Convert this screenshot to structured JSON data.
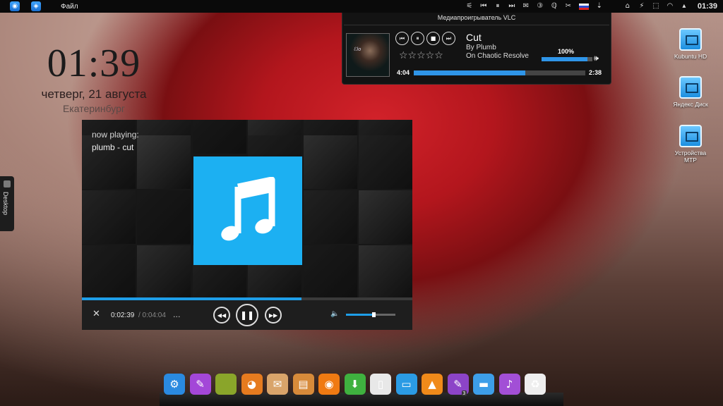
{
  "top_panel": {
    "menu_label": "Файл",
    "tray_items": [
      "⚟",
      "⏮",
      "⏸",
      "⏭",
      "✉",
      "③",
      "ℚ",
      "✂",
      "⇣",
      "",
      "⌂",
      "⚡",
      "⬚",
      "◠",
      "▴"
    ],
    "clock": "01:39"
  },
  "clock_widget": {
    "time": "01:39",
    "date": "четверг, 21 августа",
    "city": "Екатеринбург"
  },
  "desktop_tab": {
    "label": "Desktop"
  },
  "vlc": {
    "title": "Медиапроигрыватель VLC",
    "cover_text": "ℰlo",
    "buttons": [
      "⏮",
      "⏸",
      "■",
      "⏭"
    ],
    "rating": "☆☆☆☆☆",
    "track": {
      "title": "Cut",
      "artist": "By Plumb",
      "album": "On Chaotic Resolve"
    },
    "volume": {
      "label": "100%",
      "fraction": 0.9
    },
    "time": {
      "elapsed": "4:04",
      "remaining": "2:38",
      "fraction": 0.65
    }
  },
  "desktop_icons": [
    {
      "label": "Kubuntu HD"
    },
    {
      "label": "Яндекс Диск"
    },
    {
      "label": "Устройства MTP"
    }
  ],
  "music_player": {
    "now_playing_label": "now playing:",
    "now_playing_track": "plumb - cut",
    "art_icon": "music-note-icon",
    "progress_fraction": 0.664,
    "elapsed": "0:02:39",
    "total": "/ 0:04:04",
    "more": "...",
    "volume_fraction": 0.55,
    "tile_colors": [
      "#2a2a2a",
      "#353535",
      "#1f1f1f",
      "#3a3a3a",
      "#262626",
      "#2e2e2e",
      "#303030",
      "#444444",
      "#242424",
      "#3b3b3b",
      "#282828",
      "#2c2c2c",
      "#1d1d1d",
      "#333333",
      "#292929",
      "#3d3d3d",
      "#222222",
      "#373737"
    ]
  },
  "dock": {
    "items": [
      {
        "name": "settings",
        "glyph": "⚙",
        "color": "#2a8ae0"
      },
      {
        "name": "brush",
        "glyph": "✎",
        "color": "#a347d8"
      },
      {
        "name": "image",
        "glyph": "",
        "color": "#8aa52a"
      },
      {
        "name": "fox",
        "glyph": "◕",
        "color": "#e67b1f"
      },
      {
        "name": "mail",
        "glyph": "✉",
        "color": "#d9a46a"
      },
      {
        "name": "files",
        "glyph": "▤",
        "color": "#d78a3a"
      },
      {
        "name": "firefox",
        "glyph": "◉",
        "color": "#f07a12"
      },
      {
        "name": "download",
        "glyph": "⬇",
        "color": "#3fb13f"
      },
      {
        "name": "text",
        "glyph": "▯",
        "color": "#e8e8e8"
      },
      {
        "name": "notes",
        "glyph": "▭",
        "color": "#2b9be4"
      },
      {
        "name": "vlc",
        "glyph": "▲",
        "color": "#f08a1a"
      },
      {
        "name": "editor",
        "glyph": "✎",
        "color": "#8c44c8",
        "badge": "3"
      },
      {
        "name": "folder",
        "glyph": "▬",
        "color": "#3d9ee8"
      },
      {
        "name": "music",
        "glyph": "♪",
        "color": "#a24fd6"
      },
      {
        "name": "trash",
        "glyph": "♻",
        "color": "#eeeeee"
      }
    ]
  }
}
